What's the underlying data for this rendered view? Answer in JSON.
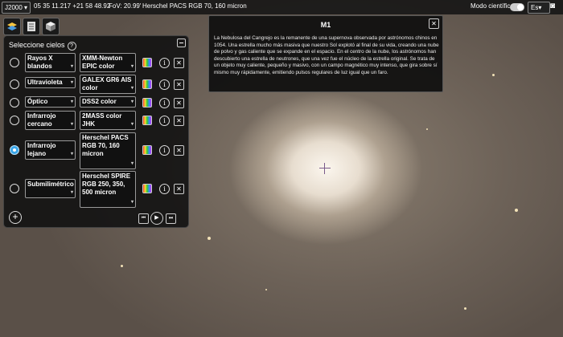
{
  "topbar": {
    "frame": "J2000",
    "coordinates": "05 35 11.217 +21 58 48.92",
    "fov": "FoV: 20.99'",
    "survey": "Herschel PACS RGB 70, 160 micron",
    "sci_mode_label": "Modo científico",
    "lang": "Es"
  },
  "panel": {
    "title": "Seleccione cielos",
    "rows": [
      {
        "band": "Rayos X blandos",
        "survey": "XMM-Newton EPIC color",
        "selected": false
      },
      {
        "band": "Ultravioleta",
        "survey": "GALEX GR6 AIS color",
        "selected": false
      },
      {
        "band": "Óptico",
        "survey": "DSS2 color",
        "selected": false
      },
      {
        "band": "Infrarrojo cercano",
        "survey": "2MASS color JHK",
        "selected": false
      },
      {
        "band": "Infrarrojo lejano",
        "survey": "Herschel PACS RGB 70, 160 micron",
        "selected": true
      },
      {
        "band": "Submilimétrico",
        "survey": "Herschel SPIRE RGB 250, 350, 500 micron",
        "selected": false
      }
    ]
  },
  "popup": {
    "title": "M1",
    "text": "La Nebulosa del Cangrejo es la remanente de una supernova observada por astrónomos chinos en 1054. Una estrella mucho más masiva que nuestro Sol explotó al final de su vida, creando una nube de polvo y gas caliente que se expande en el espacio. En el centro de la nube, los astrónomos han descubierto una estrella de neutrones, que una vez fue el núcleo de la estrella original. Se trata de un objeto muy caliente, pequeño y masivo, con un campo magnético muy intenso, que gira sobre sí mismo muy rápidamente, emitiendo pulsos regulares de luz igual que un faro."
  },
  "colors": {
    "selected_radio": "#3aa6e8",
    "panel_bg": "#121212"
  }
}
